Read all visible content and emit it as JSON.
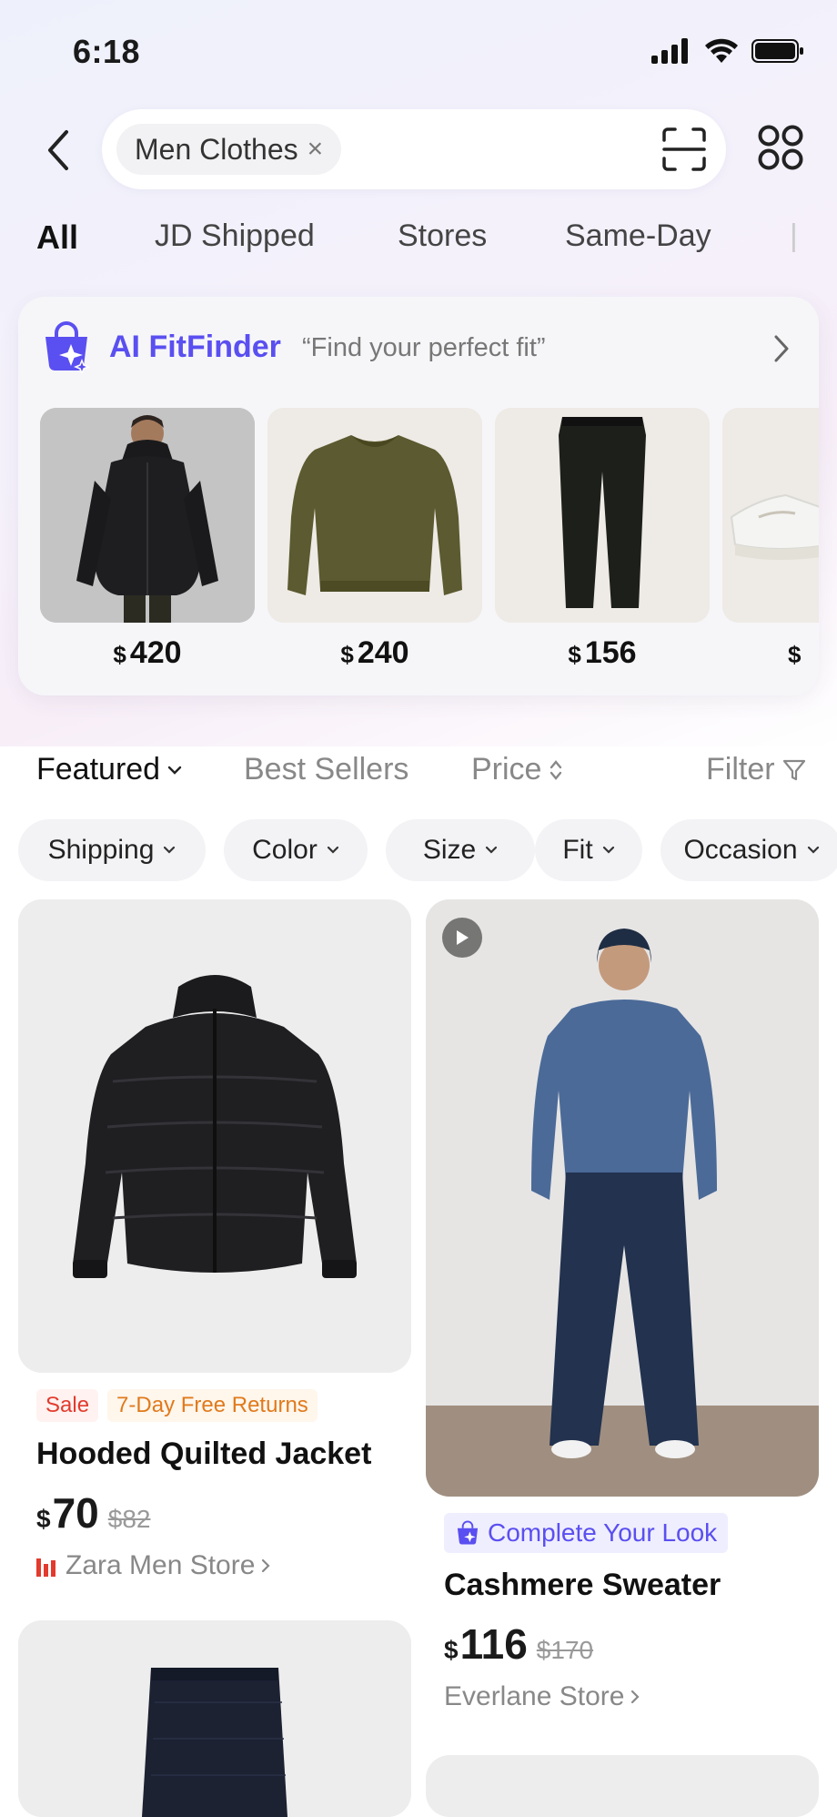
{
  "status_bar": {
    "time": "6:18"
  },
  "search": {
    "chip_text": "Men Clothes",
    "chip_clear": "×"
  },
  "category_tabs": [
    {
      "label": "All",
      "active": true
    },
    {
      "label": "JD Shipped",
      "active": false
    },
    {
      "label": "Stores",
      "active": false
    },
    {
      "label": "Same-Day",
      "active": false
    }
  ],
  "fitfinder": {
    "title": "AI FitFinder",
    "tagline": "“Find your perfect fit”",
    "items": [
      {
        "currency": "$",
        "price": "420",
        "icon": "black-puffer-jacket"
      },
      {
        "currency": "$",
        "price": "240",
        "icon": "olive-sweater"
      },
      {
        "currency": "$",
        "price": "156",
        "icon": "black-trousers"
      },
      {
        "currency": "$",
        "price": "",
        "icon": "white-sneakers"
      }
    ]
  },
  "sort_bar": {
    "featured": "Featured",
    "best_sellers": "Best Sellers",
    "price": "Price",
    "filter": "Filter"
  },
  "filter_chips": [
    "Shipping",
    "Color",
    "Size",
    "Fit",
    "Occasion"
  ],
  "products": [
    {
      "tags": [
        "Sale",
        "7-Day Free Returns"
      ],
      "title": "Hooded Quilted Jacket",
      "currency": "$",
      "price": "70",
      "old_price": "$82",
      "store": "Zara Men Store"
    },
    {
      "badge": "Complete Your Look",
      "title": "Cashmere Sweater",
      "currency": "$",
      "price": "116",
      "old_price": "$170",
      "store": "Everlane Store"
    }
  ],
  "colors": {
    "accent": "#5a4ff0",
    "sale": "#e23b2e",
    "returns": "#e07a1c"
  }
}
